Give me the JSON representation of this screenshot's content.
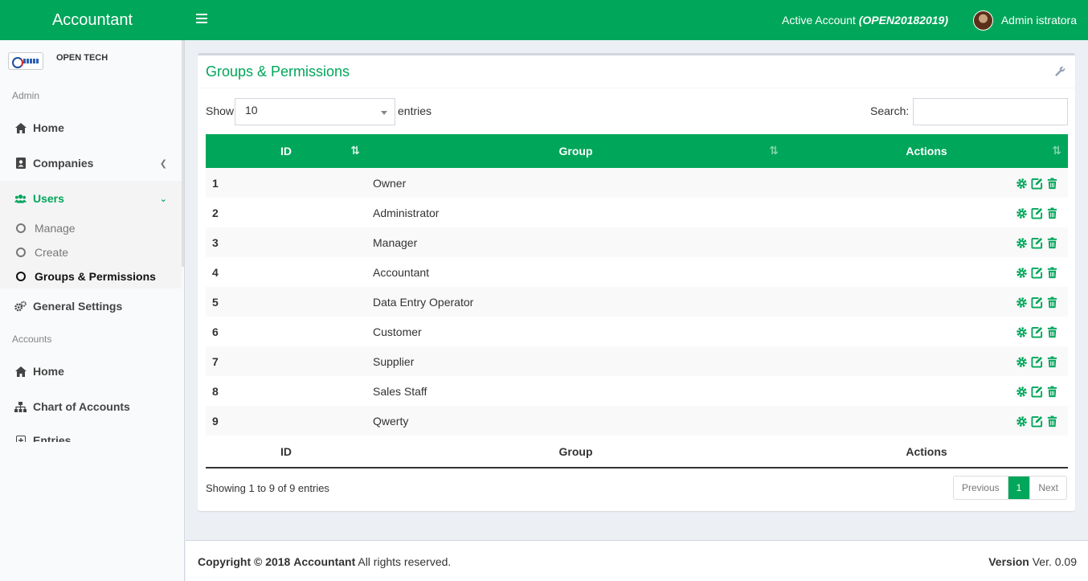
{
  "app": {
    "title": "Accountant"
  },
  "topbar": {
    "active_account_label": "Active Account",
    "active_account_value": "(OPEN20182019)",
    "user_name": "Admin istratora"
  },
  "sidebar": {
    "company_name": "OPEN TECH",
    "admin_header": "Admin",
    "accounts_header": "Accounts",
    "items": {
      "home": "Home",
      "companies": "Companies",
      "users": "Users",
      "manage": "Manage",
      "create": "Create",
      "groups": "Groups & Permissions",
      "general_settings": "General Settings",
      "accounts_home": "Home",
      "chart_of_accounts": "Chart of Accounts",
      "entries": "Entries"
    }
  },
  "panel": {
    "title": "Groups & Permissions",
    "show_label": "Show",
    "entries_value": "10",
    "entries_label": "entries",
    "search_label": "Search:"
  },
  "table": {
    "headers": [
      "ID",
      "Group",
      "Actions"
    ],
    "rows": [
      {
        "id": "1",
        "group": "Owner"
      },
      {
        "id": "2",
        "group": "Administrator"
      },
      {
        "id": "3",
        "group": "Manager"
      },
      {
        "id": "4",
        "group": "Accountant"
      },
      {
        "id": "5",
        "group": "Data Entry Operator"
      },
      {
        "id": "6",
        "group": "Customer"
      },
      {
        "id": "7",
        "group": "Supplier"
      },
      {
        "id": "8",
        "group": "Sales Staff"
      },
      {
        "id": "9",
        "group": "Qwerty"
      }
    ]
  },
  "pagination": {
    "info": "Showing 1 to 9 of 9 entries",
    "previous": "Previous",
    "current": "1",
    "next": "Next"
  },
  "footer": {
    "copyright_prefix": "Copyright © 2018",
    "copyright_brand": "Accountant",
    "copyright_suffix": "All rights reserved.",
    "version_label": "Version",
    "version_value": "Ver. 0.09"
  },
  "colors": {
    "brand": "#00a65a",
    "sidebar_bg": "#f9fafc",
    "body_bg": "#ecf0f5"
  },
  "icons": {
    "actions": [
      "gear-icon",
      "edit-icon",
      "trash-icon"
    ],
    "sidebar": [
      "home-icon",
      "address-book-icon",
      "users-icon",
      "gears-icon",
      "sitemap-icon"
    ]
  }
}
